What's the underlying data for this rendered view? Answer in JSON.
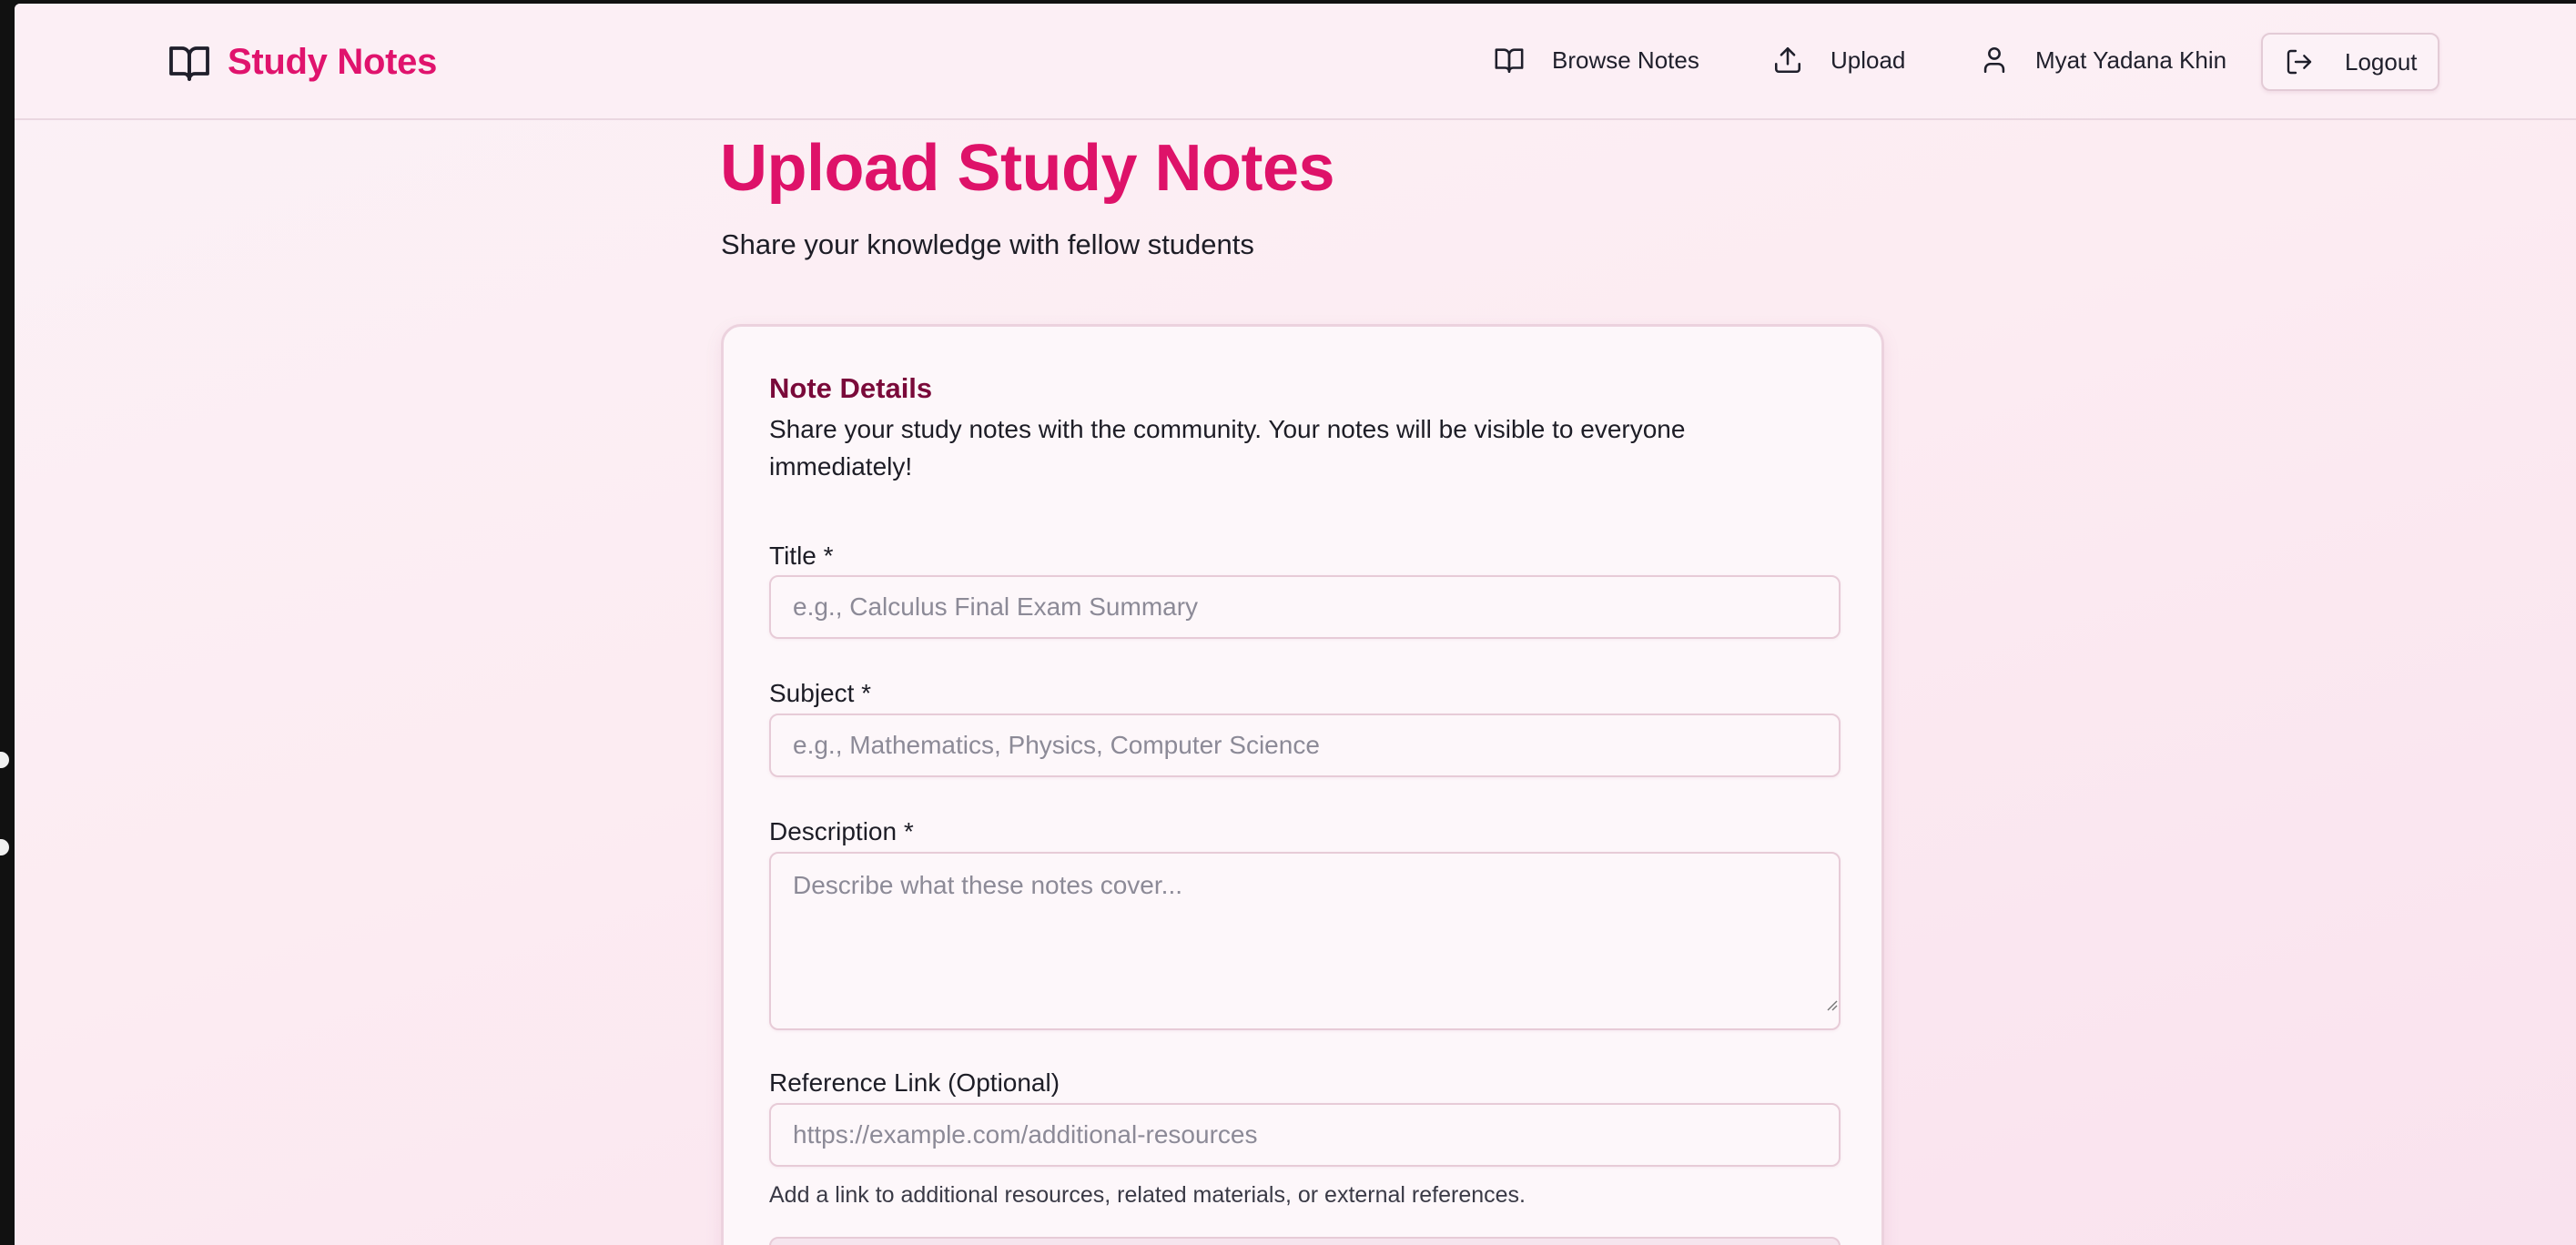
{
  "app": {
    "brand": "Study Notes",
    "accent_color": "#e0136d"
  },
  "nav": {
    "browse_label": "Browse Notes",
    "upload_label": "Upload",
    "user_name": "Myat Yadana Khin",
    "logout_label": "Logout"
  },
  "page": {
    "title": "Upload Study Notes",
    "subtitle": "Share your knowledge with fellow students"
  },
  "form": {
    "section_title": "Note Details",
    "section_desc": "Share your study notes with the community. Your notes will be visible to everyone immediately!",
    "title_label": "Title *",
    "title_placeholder": "e.g., Calculus Final Exam Summary",
    "title_value": "",
    "subject_label": "Subject *",
    "subject_placeholder": "e.g., Mathematics, Physics, Computer Science",
    "subject_value": "",
    "description_label": "Description *",
    "description_placeholder": "Describe what these notes cover...",
    "description_value": "",
    "link_label": "Reference Link (Optional)",
    "link_placeholder": "https://example.com/additional-resources",
    "link_value": "",
    "link_helper": "Add a link to additional resources, related materials, or external references."
  },
  "icons": {
    "brand": "book-open-icon",
    "browse": "book-open-icon",
    "upload": "upload-icon",
    "user": "user-icon",
    "logout": "logout-icon"
  }
}
